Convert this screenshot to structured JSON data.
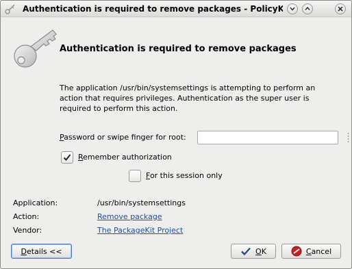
{
  "window": {
    "title": "Authentication is required to remove packages - PolicyKit-KDE",
    "minimize_icon": "chevron-down-icon",
    "maximize_icon": "chevron-up-icon",
    "close_icon": "close-icon"
  },
  "header": {
    "icon": "key-icon",
    "heading": "Authentication is required to remove packages"
  },
  "description": "The application /usr/bin/systemsettings is attempting to perform an action that requires privileges. Authentication as the super user is required to perform this action.",
  "password": {
    "label_mnemonic": "P",
    "label_rest": "assword or swipe finger for root:",
    "value": ""
  },
  "remember": {
    "mnemonic": "R",
    "label_rest": "emember authorization",
    "checked": true
  },
  "session_only": {
    "mnemonic": "F",
    "label_rest": "or this session only",
    "checked": false
  },
  "info": {
    "application_label": "Application:",
    "application_value": "/usr/bin/systemsettings",
    "action_label": "Action:",
    "action_value": "Remove package",
    "vendor_label": "Vendor:",
    "vendor_value": "The PackageKit Project"
  },
  "buttons": {
    "details_mnemonic": "D",
    "details_rest": "etails <<",
    "ok_mnemonic": "O",
    "ok_rest": "K",
    "ok_icon": "checkmark-icon",
    "cancel_mnemonic": "C",
    "cancel_rest": "ancel",
    "cancel_icon": "cancel-icon"
  },
  "colors": {
    "link": "#1f4fa0",
    "cancel_red": "#c62020"
  }
}
